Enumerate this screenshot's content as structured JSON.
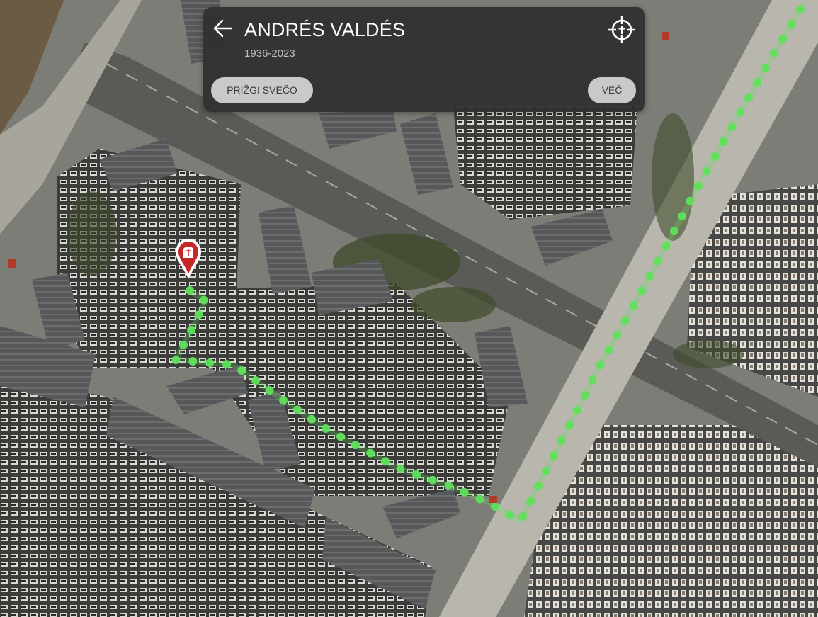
{
  "panel": {
    "title": "ANDRÉS VALDÉS",
    "dates": "1936-2023",
    "candle_button": "PRIŽGI SVEČO",
    "more_button": "VEČ"
  },
  "icons": {
    "back": "arrow-left-icon",
    "locate": "crosshair-icon",
    "marker": "grave-pin-icon"
  },
  "colors": {
    "route": "#5ee05a",
    "marker": "#c62828",
    "panel_bg": "#303030",
    "button_bg": "#c9c9c9"
  }
}
